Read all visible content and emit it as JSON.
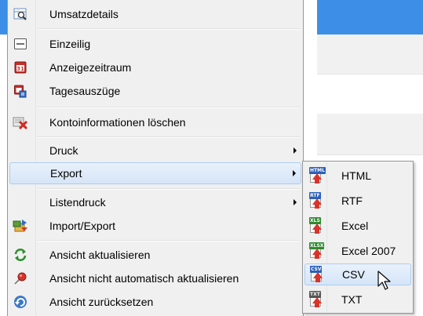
{
  "menu": {
    "items": [
      {
        "label": "Umsatzdetails",
        "icon": "magnifier-table-icon"
      },
      {
        "label": "Einzeilig",
        "icon": "single-line-icon"
      },
      {
        "label": "Anzeigezeitraum",
        "icon": "calendar-icon"
      },
      {
        "label": "Tagesauszüge",
        "icon": "daily-statement-icon"
      },
      {
        "label": "Kontoinformationen löschen",
        "icon": "delete-red-x-icon"
      },
      {
        "label": "Druck",
        "has_submenu": true
      },
      {
        "label": "Export",
        "has_submenu": true,
        "selected": true
      },
      {
        "label": "Listendruck",
        "has_submenu": true
      },
      {
        "label": "Import/Export",
        "icon": "import-export-icon"
      },
      {
        "label": "Ansicht aktualisieren",
        "icon": "refresh-icon"
      },
      {
        "label": "Ansicht nicht automatisch aktualisieren",
        "icon": "pin-icon"
      },
      {
        "label": "Ansicht zurücksetzen",
        "icon": "undo-icon"
      }
    ]
  },
  "submenu": {
    "items": [
      {
        "label": "HTML",
        "tag": "HTML",
        "tag_color": "#2c5fb8"
      },
      {
        "label": "RTF",
        "tag": "RTF",
        "tag_color": "#2c5fb8"
      },
      {
        "label": "Excel",
        "tag": "XLS",
        "tag_color": "#2f8a2f"
      },
      {
        "label": "Excel 2007",
        "tag": "XLSX",
        "tag_color": "#2f8a2f"
      },
      {
        "label": "CSV",
        "tag": "CSV",
        "tag_color": "#2c5fb8",
        "selected": true
      },
      {
        "label": "TXT",
        "tag": "TXT",
        "tag_color": "#555555"
      }
    ]
  },
  "colors": {
    "selection_border": "#aecbef",
    "header_blue": "#3d8ee6",
    "menu_bg": "#f0f0f0"
  }
}
